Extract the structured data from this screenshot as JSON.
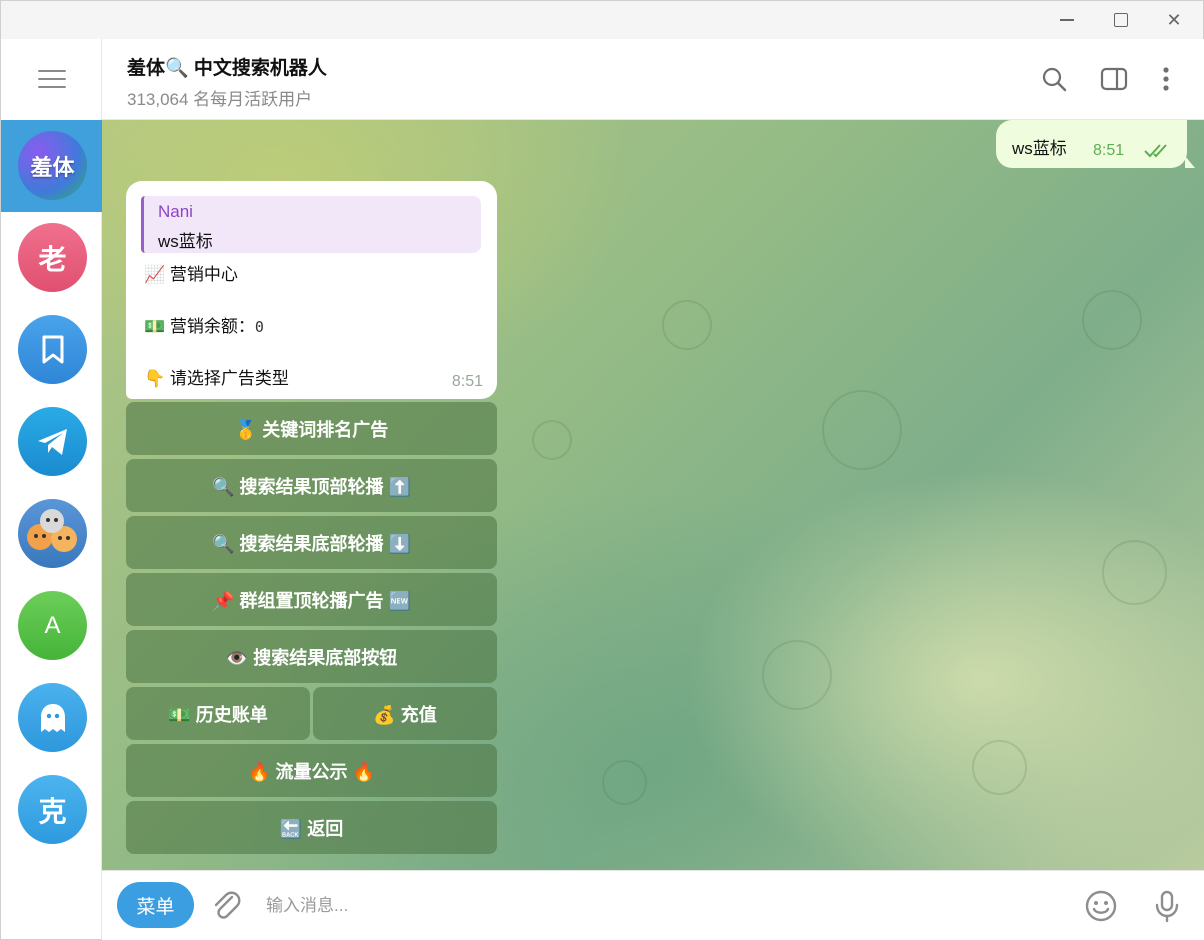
{
  "window": {
    "controls": [
      "minimize",
      "maximize",
      "close"
    ]
  },
  "sidebar": {
    "chats": [
      {
        "label": "羞体",
        "color": "#6a4fd8",
        "active": true
      },
      {
        "label": "老",
        "color": "#e7577b"
      },
      {
        "label": "",
        "icon": "bookmark-icon",
        "color": "#3b93e0"
      },
      {
        "label": "",
        "icon": "telegram-icon",
        "color": "#2a9fd8"
      },
      {
        "label": "",
        "icon": "cats-avatar",
        "color": "#4a86c8"
      },
      {
        "label": "A",
        "color": "#55c144"
      },
      {
        "label": "",
        "icon": "ghost-icon",
        "color": "#3ea6e6"
      },
      {
        "label": "克",
        "color": "#3fa9e9"
      }
    ]
  },
  "header": {
    "title": "羞体🔍 中文搜索机器人",
    "subtitle": "313,064 名每月活跃用户"
  },
  "messages": {
    "outgoing": {
      "text": "ws蓝标",
      "time": "8:51",
      "status": "read"
    },
    "incoming": {
      "reply_name": "Nani",
      "reply_text": "ws蓝标",
      "line1": "📈 营销中心",
      "line2_label": "💵 营销余额：",
      "line2_value": "0",
      "line3": "👇 请选择广告类型",
      "time": "8:51"
    }
  },
  "keyboard": {
    "btn1": "🥇 关键词排名广告",
    "btn2": "🔍 搜索结果顶部轮播 ⬆️",
    "btn3": "🔍 搜索结果底部轮播 ⬇️",
    "btn4": "📌 群组置顶轮播广告 🆕",
    "btn5": "👁️ 搜索结果底部按钮",
    "btn6a": "💵 历史账单",
    "btn6b": "💰 充值",
    "btn7": "🔥 流量公示 🔥",
    "btn8": "🔙 返回"
  },
  "composer": {
    "menu_label": "菜单",
    "placeholder": "输入消息..."
  }
}
